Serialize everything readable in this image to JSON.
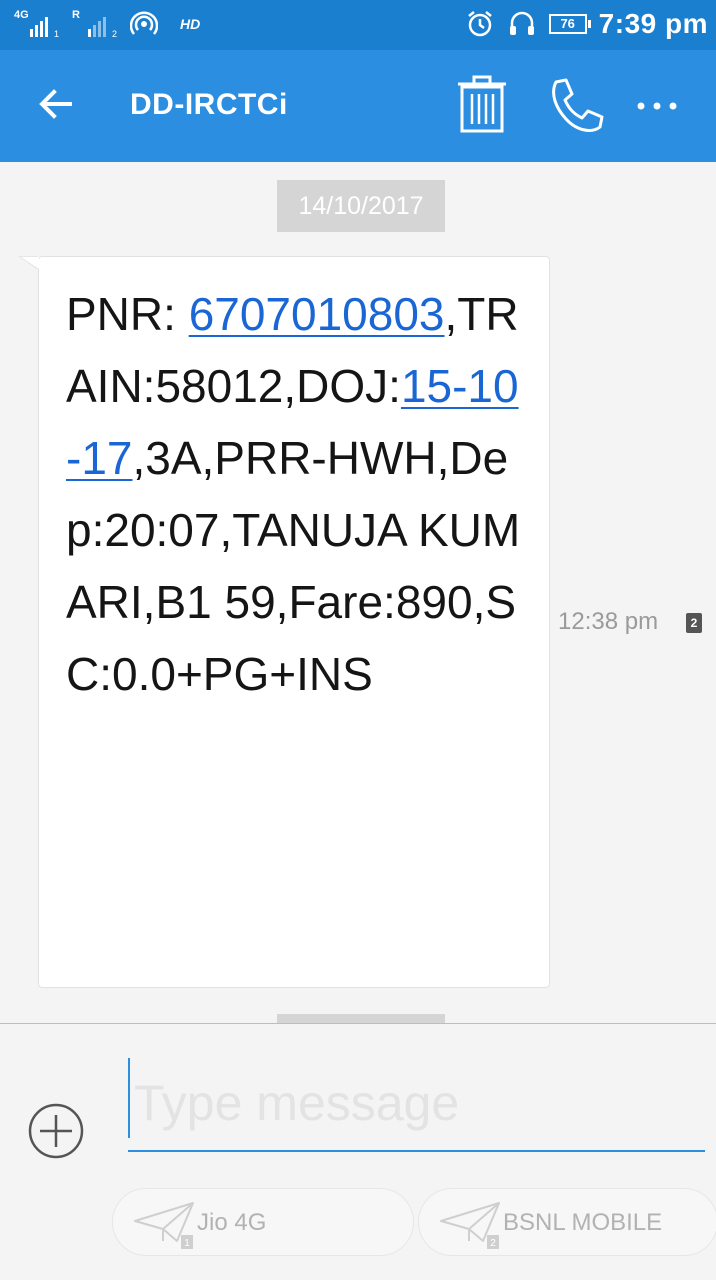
{
  "status_bar": {
    "sim1_network": "4G",
    "sim1_sub": "1",
    "sim2_network": "R",
    "sim2_sub": "2",
    "hd": "HD",
    "battery_level": "76",
    "time": "7:39 pm"
  },
  "header": {
    "title": "DD-IRCTCi",
    "icons": [
      "back-arrow-icon",
      "trash-icon",
      "phone-icon",
      "more-icon"
    ]
  },
  "conversation": {
    "date": "14/10/2017",
    "message": {
      "text_before_pnr": "PNR: ",
      "pnr_link": "6707010803",
      "text_before_doj": ",TRAIN:58012,DOJ:",
      "doj_link": "15-10-17",
      "text_after": ",3A,PRR-HWH,Dep:20:07,TANUJA KUMARI,B1 59,Fare:890,SC:0.0+PG+INS",
      "time": "12:38 pm",
      "sim_badge": "2"
    }
  },
  "compose": {
    "placeholder": "Type message",
    "value": ""
  },
  "send_buttons": [
    {
      "label": "Jio 4G",
      "sim": "1"
    },
    {
      "label": "BSNL MOBILE",
      "sim": "2"
    }
  ],
  "colors": {
    "status_bar": "#1b7fd0",
    "app_bar": "#2b8ee0",
    "link": "#1a66d4",
    "background": "#f4f4f4"
  }
}
